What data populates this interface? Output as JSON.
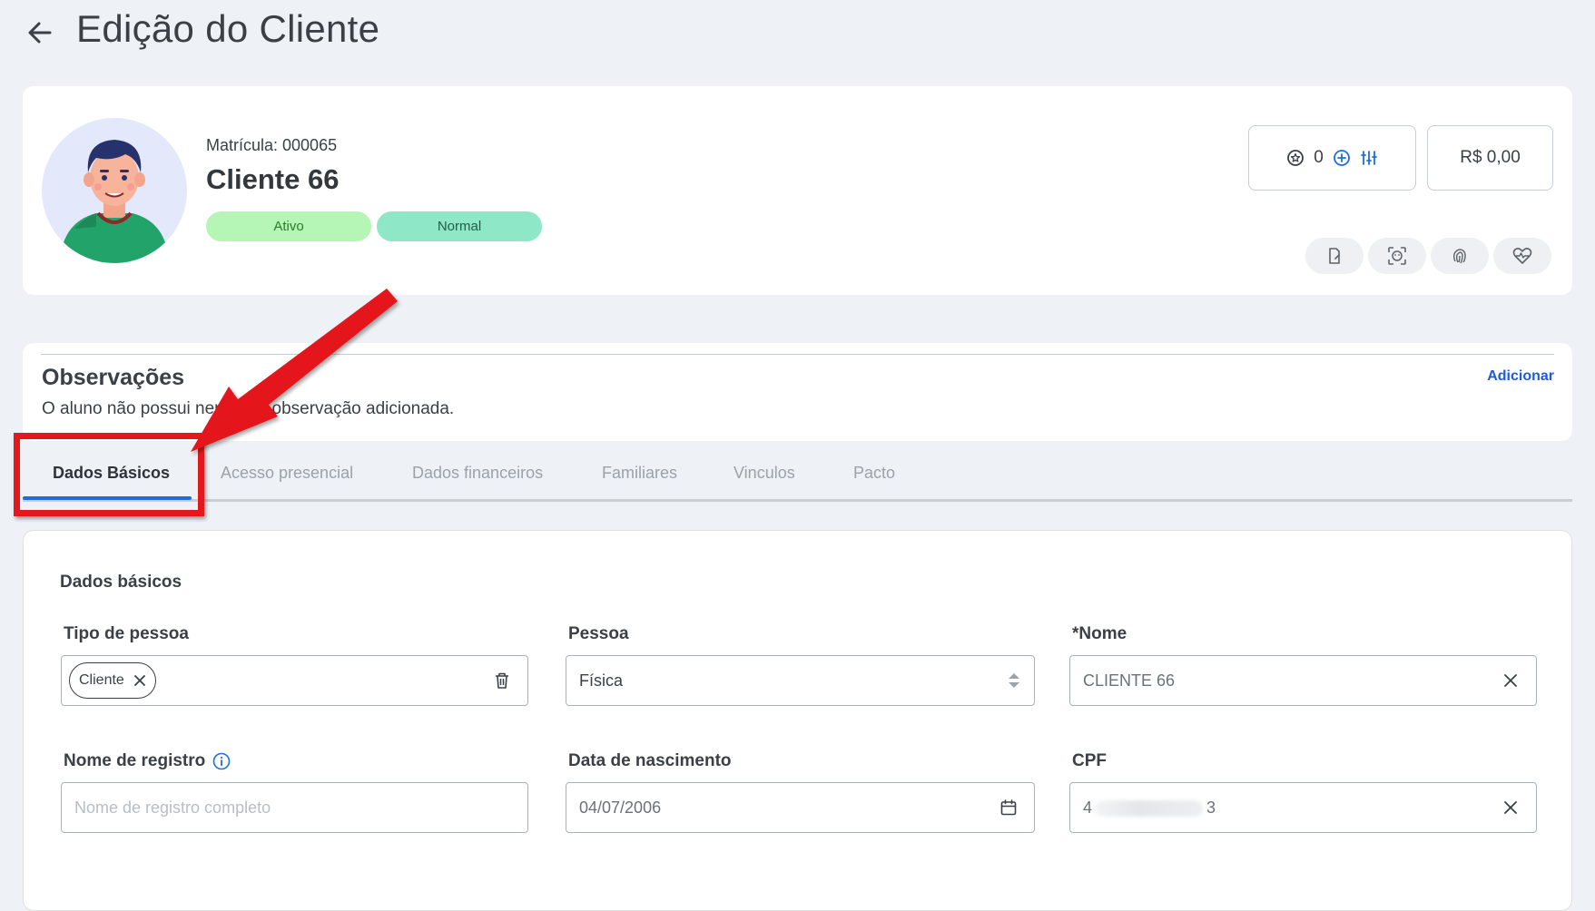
{
  "header": {
    "title": "Edição do Cliente"
  },
  "profile": {
    "matricula": "Matrícula: 000065",
    "name": "Cliente 66",
    "status_badge": "Ativo",
    "type_badge": "Normal",
    "points": "0",
    "balance": "R$ 0,00"
  },
  "observations": {
    "title": "Observações",
    "empty_text": "O aluno não possui nenhuma observação adicionada.",
    "add_label": "Adicionar"
  },
  "tabs": [
    {
      "label": "Dados Básicos",
      "active": true
    },
    {
      "label": "Acesso presencial"
    },
    {
      "label": "Dados financeiros"
    },
    {
      "label": "Familiares"
    },
    {
      "label": "Vinculos"
    },
    {
      "label": "Pacto"
    }
  ],
  "form": {
    "section_title": "Dados básicos",
    "tipo_pessoa": {
      "label": "Tipo de pessoa",
      "chip": "Cliente"
    },
    "pessoa": {
      "label": "Pessoa",
      "value": "Física"
    },
    "nome": {
      "label": "*Nome",
      "value": "CLIENTE 66"
    },
    "nome_registro": {
      "label": "Nome de registro",
      "placeholder": "Nome de registro completo"
    },
    "data_nascimento": {
      "label": "Data de nascimento",
      "value": "04/07/2006"
    },
    "cpf": {
      "label": "CPF",
      "value_start": "4",
      "value_end": "3"
    }
  },
  "colors": {
    "accent": "#1e6fd9",
    "annotation": "#e4181c",
    "badge_ativo": "#b5f5b5",
    "badge_normal": "#8ee8c8"
  }
}
